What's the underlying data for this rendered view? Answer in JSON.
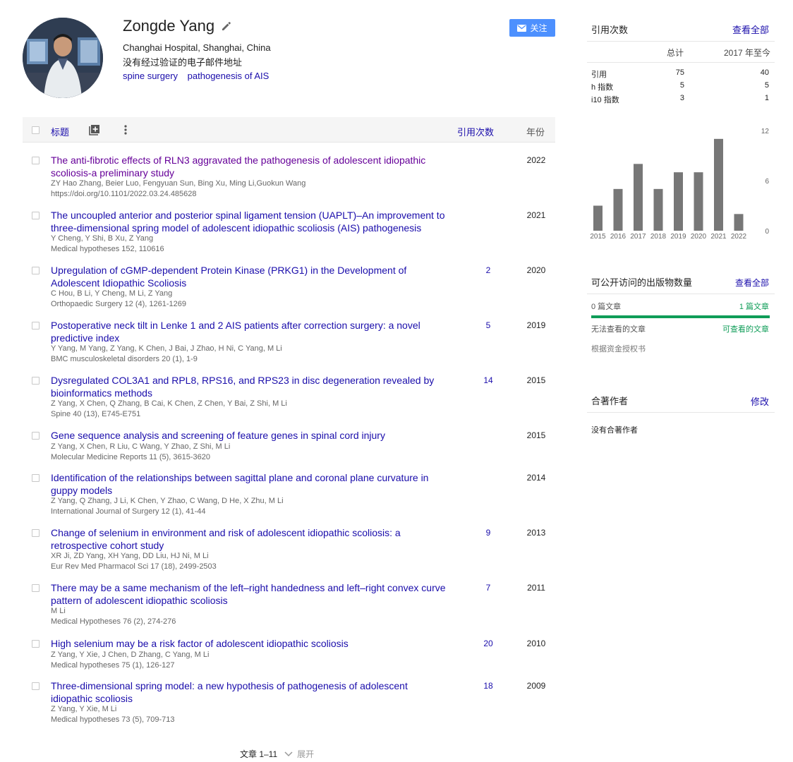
{
  "profile": {
    "name": "Zongde Yang",
    "affiliation": "Changhai Hospital, Shanghai, China",
    "email_status": "没有经过验证的电子邮件地址",
    "interests": [
      "spine surgery",
      "pathogenesis of AIS"
    ],
    "follow_label": "关注",
    "accent_color": "#4d90fe"
  },
  "table": {
    "header": {
      "title": "标题",
      "cites": "引用次数",
      "year": "年份"
    },
    "articles": [
      {
        "title": "The anti-fibrotic effects of RLN3 aggravated the pathogenesis of adolescent idiopathic scoliosis-a preliminary study",
        "authors": "ZY Hao Zhang, Beier Luo, Fengyuan Sun, Bing Xu, Ming Li,Guokun Wang",
        "venue": "https://doi.org/10.1101/2022.03.24.485628",
        "cites": "",
        "year": "2022",
        "visited": true
      },
      {
        "title": "The uncoupled anterior and posterior spinal ligament tension (UAPLT)–An improvement to three-dimensional spring model of adolescent idiopathic scoliosis (AIS) pathogenesis",
        "authors": "Y Cheng, Y Shi, B Xu, Z Yang",
        "venue": "Medical hypotheses 152, 110616",
        "cites": "",
        "year": "2021",
        "visited": false
      },
      {
        "title": "Upregulation of cGMP-dependent Protein Kinase (PRKG1) in the Development of Adolescent Idiopathic Scoliosis",
        "authors": "C Hou, B Li, Y Cheng, M Li, Z Yang",
        "venue": "Orthopaedic Surgery 12 (4), 1261-1269",
        "cites": "2",
        "year": "2020",
        "visited": false
      },
      {
        "title": "Postoperative neck tilt in Lenke 1 and 2 AIS patients after correction surgery: a novel predictive index",
        "authors": "Y Yang, M Yang, Z Yang, K Chen, J Bai, J Zhao, H Ni, C Yang, M Li",
        "venue": "BMC musculoskeletal disorders 20 (1), 1-9",
        "cites": "5",
        "year": "2019",
        "visited": false
      },
      {
        "title": "Dysregulated COL3A1 and RPL8, RPS16, and RPS23 in disc degeneration revealed by bioinformatics methods",
        "authors": "Z Yang, X Chen, Q Zhang, B Cai, K Chen, Z Chen, Y Bai, Z Shi, M Li",
        "venue": "Spine 40 (13), E745-E751",
        "cites": "14",
        "year": "2015",
        "visited": false
      },
      {
        "title": "Gene sequence analysis and screening of feature genes in spinal cord injury",
        "authors": "Z Yang, X Chen, R Liu, C Wang, Y Zhao, Z Shi, M Li",
        "venue": "Molecular Medicine Reports 11 (5), 3615-3620",
        "cites": "",
        "year": "2015",
        "visited": false
      },
      {
        "title": "Identification of the relationships between sagittal plane and coronal plane curvature in guppy models",
        "authors": "Z Yang, Q Zhang, J Li, K Chen, Y Zhao, C Wang, D He, X Zhu, M Li",
        "venue": "International Journal of Surgery 12 (1), 41-44",
        "cites": "",
        "year": "2014",
        "visited": false
      },
      {
        "title": "Change of selenium in environment and risk of adolescent idiopathic scoliosis: a retrospective cohort study",
        "authors": "XR Ji, ZD Yang, XH Yang, DD Liu, HJ Ni, M Li",
        "venue": "Eur Rev Med Pharmacol Sci 17 (18), 2499-2503",
        "cites": "9",
        "year": "2013",
        "visited": false
      },
      {
        "title": "There may be a same mechanism of the left–right handedness and left–right convex curve pattern of adolescent idiopathic scoliosis",
        "authors": "M Li",
        "venue": "Medical Hypotheses 76 (2), 274-276",
        "cites": "7",
        "year": "2011",
        "visited": false
      },
      {
        "title": "High selenium may be a risk factor of adolescent idiopathic scoliosis",
        "authors": "Z Yang, Y Xie, J Chen, D Zhang, C Yang, M Li",
        "venue": "Medical hypotheses 75 (1), 126-127",
        "cites": "20",
        "year": "2010",
        "visited": false
      },
      {
        "title": "Three-dimensional spring model: a new hypothesis of pathogenesis of adolescent idiopathic scoliosis",
        "authors": "Z Yang, Y Xie, M Li",
        "venue": "Medical hypotheses 73 (5), 709-713",
        "cites": "18",
        "year": "2009",
        "visited": false
      }
    ],
    "pager": {
      "range": "文章 1–11",
      "expand": "展开"
    }
  },
  "citations": {
    "heading": "引用次数",
    "view_all": "查看全部",
    "col_total": "总计",
    "col_since": "2017 年至今",
    "rows": [
      {
        "label": "引用",
        "total": "75",
        "since": "40"
      },
      {
        "label": "h 指数",
        "total": "5",
        "since": "5"
      },
      {
        "label": "i10 指数",
        "total": "3",
        "since": "1"
      }
    ]
  },
  "chart_data": {
    "type": "bar",
    "categories": [
      "2015",
      "2016",
      "2017",
      "2018",
      "2019",
      "2020",
      "2021",
      "2022"
    ],
    "values": [
      3,
      5,
      8,
      5,
      7,
      7,
      11,
      2
    ],
    "ylim": [
      0,
      12
    ],
    "yticks": [
      "0",
      "6",
      "12"
    ],
    "bar_color": "#777777",
    "grid": false
  },
  "public_access": {
    "heading": "可公开访问的出版物数量",
    "view_all": "查看全部",
    "unavailable_count": "0 篇文章",
    "available_count": "1 篇文章",
    "unavailable_label": "无法查看的文章",
    "available_label": "可查看的文章",
    "mandate_label": "根据资金授权书",
    "available_color": "#0f9d58"
  },
  "coauthors": {
    "heading": "合著作者",
    "edit": "修改",
    "empty": "没有合著作者"
  }
}
